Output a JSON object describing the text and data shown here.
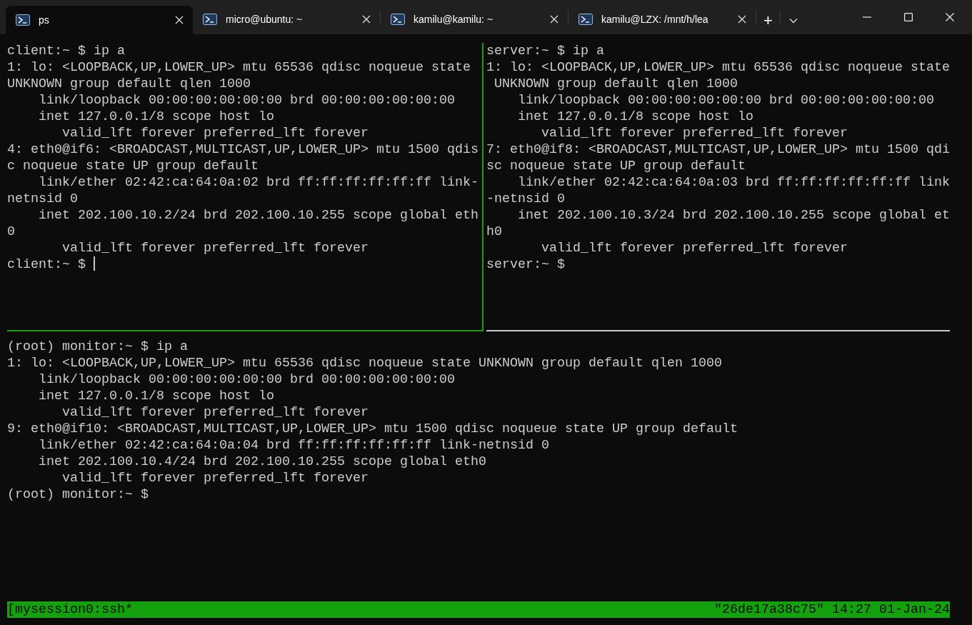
{
  "tabs": [
    {
      "title": "ps",
      "selected": true
    },
    {
      "title": "micro@ubuntu: ~",
      "selected": false
    },
    {
      "title": "kamilu@kamilu: ~",
      "selected": false
    },
    {
      "title": "kamilu@LZX: /mnt/h/lea",
      "selected": false
    }
  ],
  "new_tab": "+",
  "panes": [
    {
      "active": true,
      "cursor": true,
      "lines": [
        "client:~ $ ip a",
        "1: lo: <LOOPBACK,UP,LOWER_UP> mtu 65536 qdisc noqueue state",
        "UNKNOWN group default qlen 1000",
        "    link/loopback 00:00:00:00:00:00 brd 00:00:00:00:00:00",
        "    inet 127.0.0.1/8 scope host lo",
        "       valid_lft forever preferred_lft forever",
        "4: eth0@if6: <BROADCAST,MULTICAST,UP,LOWER_UP> mtu 1500 qdis",
        "c noqueue state UP group default",
        "    link/ether 02:42:ca:64:0a:02 brd ff:ff:ff:ff:ff:ff link-",
        "netnsid 0",
        "    inet 202.100.10.2/24 brd 202.100.10.255 scope global eth",
        "0",
        "       valid_lft forever preferred_lft forever",
        "client:~ $ "
      ]
    },
    {
      "active": false,
      "cursor": false,
      "lines": [
        "server:~ $ ip a",
        "1: lo: <LOOPBACK,UP,LOWER_UP> mtu 65536 qdisc noqueue state",
        " UNKNOWN group default qlen 1000",
        "    link/loopback 00:00:00:00:00:00 brd 00:00:00:00:00:00",
        "    inet 127.0.0.1/8 scope host lo",
        "       valid_lft forever preferred_lft forever",
        "7: eth0@if8: <BROADCAST,MULTICAST,UP,LOWER_UP> mtu 1500 qdi",
        "sc noqueue state UP group default",
        "    link/ether 02:42:ca:64:0a:03 brd ff:ff:ff:ff:ff:ff link",
        "-netnsid 0",
        "    inet 202.100.10.3/24 brd 202.100.10.255 scope global et",
        "h0",
        "       valid_lft forever preferred_lft forever",
        "server:~ $"
      ]
    },
    {
      "active": false,
      "cursor": false,
      "lines": [
        "(root) monitor:~ $ ip a",
        "1: lo: <LOOPBACK,UP,LOWER_UP> mtu 65536 qdisc noqueue state UNKNOWN group default qlen 1000",
        "    link/loopback 00:00:00:00:00:00 brd 00:00:00:00:00:00",
        "    inet 127.0.0.1/8 scope host lo",
        "       valid_lft forever preferred_lft forever",
        "9: eth0@if10: <BROADCAST,MULTICAST,UP,LOWER_UP> mtu 1500 qdisc noqueue state UP group default",
        "    link/ether 02:42:ca:64:0a:04 brd ff:ff:ff:ff:ff:ff link-netnsid 0",
        "    inet 202.100.10.4/24 brd 202.100.10.255 scope global eth0",
        "       valid_lft forever preferred_lft forever",
        "(root) monitor:~ $"
      ]
    }
  ],
  "status_bar": {
    "left": "[mysession0:ssh*",
    "right": "\"26de17a38c75\" 14:27 01-Jan-24"
  }
}
